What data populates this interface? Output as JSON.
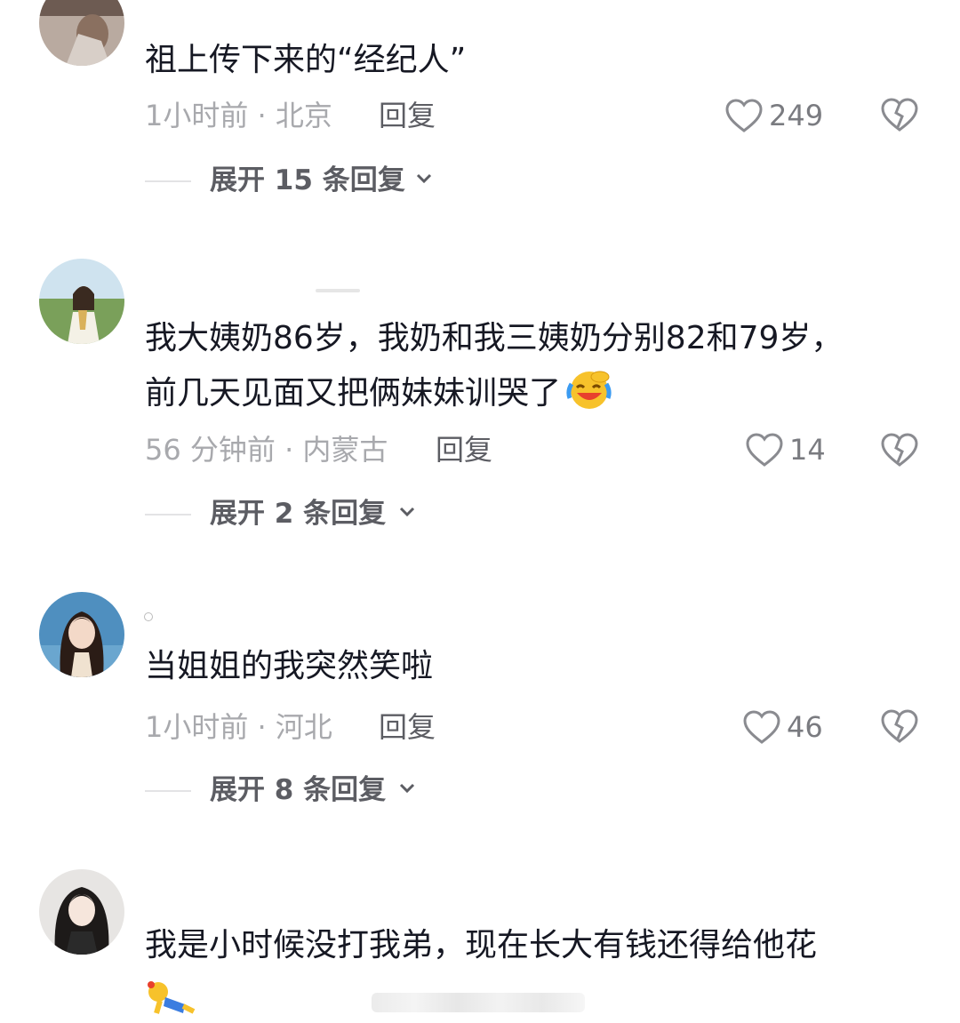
{
  "comments": [
    {
      "lines": [
        "祖上传下来的“经纪人”"
      ],
      "time_location": "1小时前 · 北京",
      "reply_label": "回复",
      "like_count": "249",
      "expand_label": "展开 15 条回复"
    },
    {
      "lines": [
        "我大姨奶86岁，我奶和我三姨奶分别82和79岁，",
        "前几天见面又把俩妹妹训哭了"
      ],
      "time_location": "56 分钟前 · 内蒙古",
      "reply_label": "回复",
      "like_count": "14",
      "expand_label": "展开 2 条回复"
    },
    {
      "lines": [
        "当姐姐的我突然笑啦"
      ],
      "time_location": "1小时前 · 河北",
      "reply_label": "回复",
      "like_count": "46",
      "expand_label": "展开 8 条回复"
    },
    {
      "lines": [
        "我是小时候没打我弟，现在长大有钱还得给他花"
      ]
    }
  ],
  "icons": {
    "like": "heart-outline-icon",
    "dislike": "broken-heart-icon",
    "expand": "chevron-down-icon",
    "laugh_emoji": "laughing-crying-emoji",
    "sticker": "yellow-figure-sticker"
  },
  "colors": {
    "text_primary": "#161823",
    "text_secondary": "#a8a9ad",
    "reply_text": "#5c5d63",
    "divider": "#e3e3e5"
  }
}
